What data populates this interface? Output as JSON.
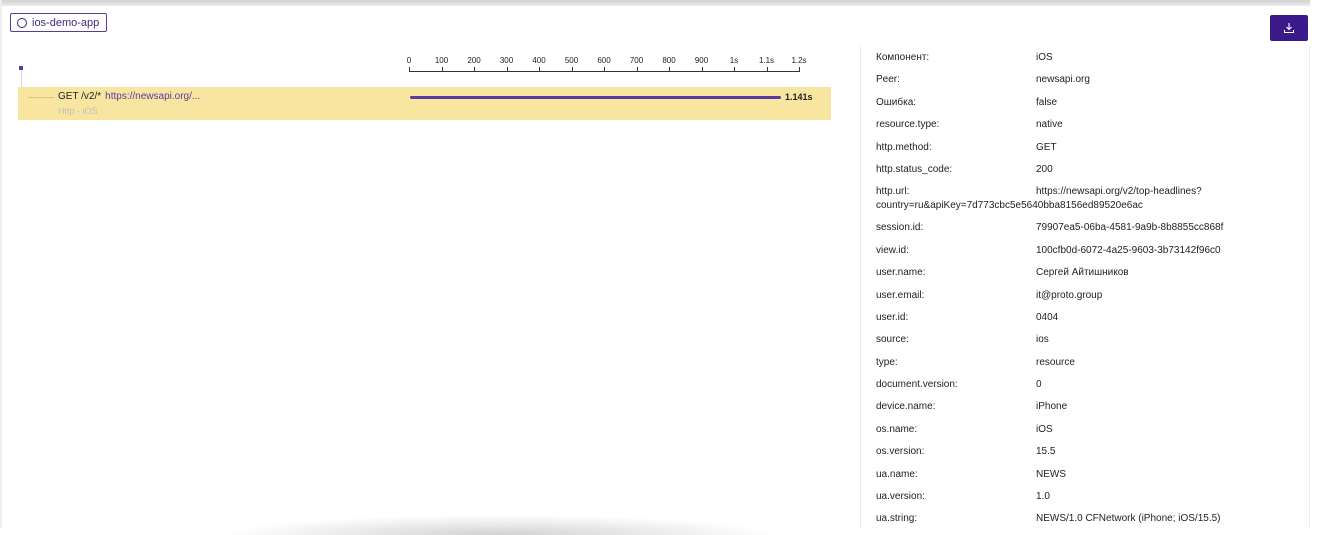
{
  "header": {
    "service_tag": "ios-demo-app",
    "download_icon": "download-icon",
    "accent": "#3a1a8a"
  },
  "timeline": {
    "ticks": [
      "0",
      "100",
      "200",
      "300",
      "400",
      "500",
      "600",
      "700",
      "800",
      "900",
      "1s",
      "1.1s",
      "1.2s"
    ]
  },
  "span": {
    "operation": "GET /v2/*",
    "url": "https://newsapi.org/...",
    "service": "Http - iOS",
    "duration_label": "1.141s",
    "duration_s": 1.141,
    "axis_max_s": 1.2,
    "highlight": "#f8e6a0"
  },
  "attributes": [
    {
      "key": "Компонент:",
      "value": "iOS"
    },
    {
      "key": "Peer:",
      "value": "newsapi.org"
    },
    {
      "key": "Ошибка:",
      "value": "false"
    },
    {
      "key": "resource.type:",
      "value": "native"
    },
    {
      "key": "http.method:",
      "value": "GET"
    },
    {
      "key": "http.status_code:",
      "value": "200"
    },
    {
      "key": "http.url:",
      "value": "https://newsapi.org/v2/top-headlines?",
      "value2": "country=ru&apiKey=7d773cbc5e5640bba8156ed89520e6ac"
    },
    {
      "key": "session.id:",
      "value": "79907ea5-06ba-4581-9a9b-8b8855cc868f"
    },
    {
      "key": "view.id:",
      "value": "100cfb0d-6072-4a25-9603-3b73142f96c0"
    },
    {
      "key": "user.name:",
      "value": "Сергей Айтишников"
    },
    {
      "key": "user.email:",
      "value": "it@proto.group"
    },
    {
      "key": "user.id:",
      "value": "0404"
    },
    {
      "key": "source:",
      "value": "ios"
    },
    {
      "key": "type:",
      "value": "resource"
    },
    {
      "key": "document.version:",
      "value": "0"
    },
    {
      "key": "device.name:",
      "value": "iPhone"
    },
    {
      "key": "os.name:",
      "value": "iOS"
    },
    {
      "key": "os.version:",
      "value": "15.5"
    },
    {
      "key": "ua.name:",
      "value": "NEWS"
    },
    {
      "key": "ua.version:",
      "value": "1.0"
    },
    {
      "key": "ua.string:",
      "value": "NEWS/1.0 CFNetwork (iPhone; iOS/15.5)"
    }
  ]
}
